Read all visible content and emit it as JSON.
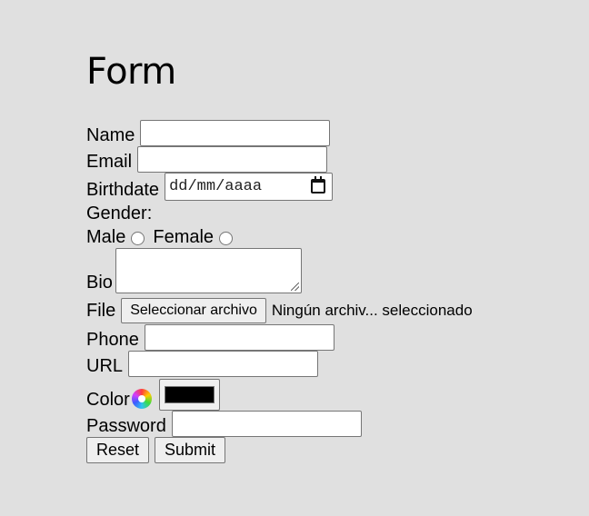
{
  "form": {
    "title": "Form",
    "name_label": "Name",
    "email_label": "Email",
    "birthdate_label": "Birthdate",
    "birthdate_placeholder": "dd/mm/aaaa",
    "gender_label": "Gender:",
    "male_label": "Male",
    "female_label": "Female",
    "bio_label": "Bio",
    "file_label": "File",
    "file_button": "Seleccionar archivo",
    "file_status": "Ningún archiv... seleccionado",
    "phone_label": "Phone",
    "url_label": "URL",
    "color_label": "Color",
    "color_value": "#000000",
    "password_label": "Password",
    "reset_label": "Reset",
    "submit_label": "Submit"
  }
}
